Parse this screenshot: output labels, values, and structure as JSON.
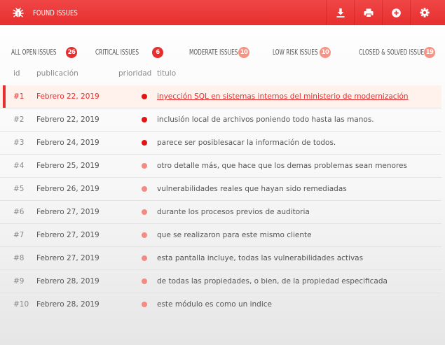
{
  "header": {
    "title": "Found issues",
    "icon": "bug-icon",
    "toolbar": [
      {
        "name": "download-button",
        "icon": "download-icon"
      },
      {
        "name": "print-button",
        "icon": "print-icon"
      },
      {
        "name": "add-button",
        "icon": "plus-circle-icon"
      },
      {
        "name": "settings-button",
        "icon": "gear-icon"
      }
    ]
  },
  "tabs": [
    {
      "label": "All open issues",
      "count": "26",
      "color": "#e72e2e"
    },
    {
      "label": "Critical issues",
      "count": "6",
      "color": "#e72e2e"
    },
    {
      "label": "Moderate issues",
      "count": "10",
      "color": "#f59385"
    },
    {
      "label": "Low risk issues",
      "count": "10",
      "color": "#f59385"
    },
    {
      "label": "Closed & solved issues",
      "count": "19",
      "color": "#f59385"
    }
  ],
  "table": {
    "columns": {
      "id": "id",
      "date": "publicación",
      "priority": "prioridad",
      "title": "titulo"
    },
    "priority_colors": {
      "critical": "#e11515",
      "moderate": "#f48a82"
    },
    "rows": [
      {
        "id": "#1",
        "date": "Febrero 22, 2019",
        "priority": "critical",
        "title": "inyección SQL en sistemas internos del ministerio de modernización",
        "selected": true
      },
      {
        "id": "#2",
        "date": "Febrero 22, 2019",
        "priority": "critical",
        "title": "inclusión local de archivos poniendo todo hasta las manos."
      },
      {
        "id": "#3",
        "date": "Febrero 24, 2019",
        "priority": "critical",
        "title": "parece ser posiblesacar la información de todos."
      },
      {
        "id": "#4",
        "date": "Febrero 25, 2019",
        "priority": "moderate",
        "title": "otro detalle más, que hace que los demas problemas sean menores"
      },
      {
        "id": "#5",
        "date": "Febrero 26, 2019",
        "priority": "moderate",
        "title": "vulnerabilidades reales que hayan sido remediadas"
      },
      {
        "id": "#6",
        "date": "Febrero 27, 2019",
        "priority": "moderate",
        "title": "durante los procesos previos de auditoria"
      },
      {
        "id": "#7",
        "date": "Febrero 27, 2019",
        "priority": "moderate",
        "title": "que se realizaron para este mismo cliente"
      },
      {
        "id": "#8",
        "date": "Febrero 27, 2019",
        "priority": "moderate",
        "title": "esta pantalla incluye, todas las vulnerabilidades activas"
      },
      {
        "id": "#9",
        "date": "Febrero 28, 2019",
        "priority": "moderate",
        "title": "de todas las propiedades, o bien, de la propiedad especificada"
      },
      {
        "id": "#10",
        "date": "Febrero 28, 2019",
        "priority": "moderate",
        "title": "este módulo es como un indice"
      }
    ]
  }
}
